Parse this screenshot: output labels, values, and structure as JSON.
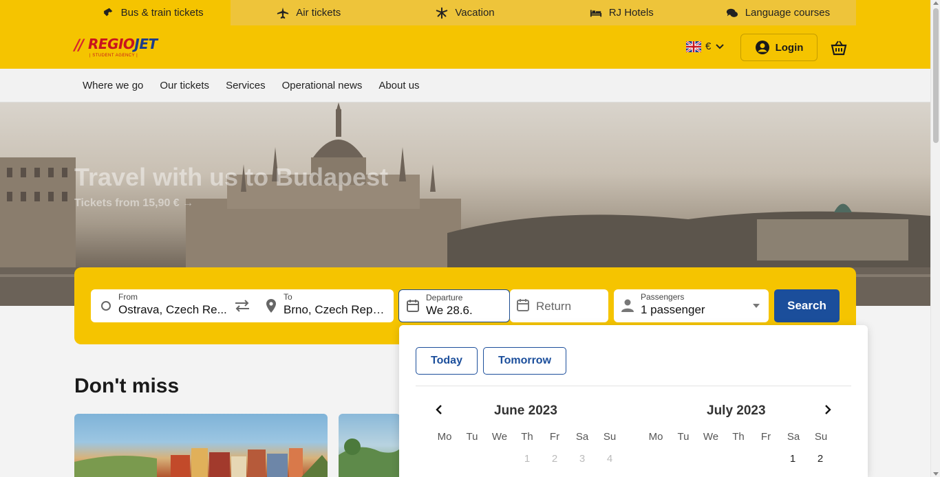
{
  "product_tabs": [
    {
      "label": "Bus & train tickets",
      "icon": "ticket-icon",
      "active": true
    },
    {
      "label": "Air tickets",
      "icon": "airplane-icon",
      "active": false
    },
    {
      "label": "Vacation",
      "icon": "palm-tree-icon",
      "active": false
    },
    {
      "label": "RJ Hotels",
      "icon": "bed-icon",
      "active": false
    },
    {
      "label": "Language courses",
      "icon": "chat-bubbles-icon",
      "active": false
    }
  ],
  "header": {
    "logo_bars": "//",
    "logo_regio": "REGIO",
    "logo_jet": "JET",
    "logo_sub": "| STUDENT AGENCY |",
    "currency": "€",
    "login_label": "Login"
  },
  "nav": [
    "Where we go",
    "Our tickets",
    "Services",
    "Operational news",
    "About us"
  ],
  "hero": {
    "title": "Travel with us to Budapest",
    "subtitle": "Tickets from 15,90 € →"
  },
  "search": {
    "from_label": "From",
    "from_value": "Ostrava, Czech Re...",
    "to_label": "To",
    "to_value": "Brno, Czech Repu...",
    "departure_label": "Departure",
    "departure_value": "We 28.6.",
    "return_placeholder": "Return",
    "passengers_label": "Passengers",
    "passengers_value": "1 passenger",
    "search_label": "Search"
  },
  "section_title": "Don't miss",
  "calendar": {
    "today_label": "Today",
    "tomorrow_label": "Tomorrow",
    "months": [
      {
        "title": "June 2023",
        "days_visible": [
          "1",
          "2",
          "3",
          "4"
        ],
        "muted": true
      },
      {
        "title": "July 2023",
        "days_visible": [
          "1",
          "2"
        ],
        "muted": false
      }
    ],
    "weekdays": [
      "Mo",
      "Tu",
      "We",
      "Th",
      "Fr",
      "Sa",
      "Su"
    ]
  },
  "colors": {
    "brand_yellow": "#f5c400",
    "brand_blue": "#1b4e9b",
    "logo_red": "#c8141e"
  }
}
